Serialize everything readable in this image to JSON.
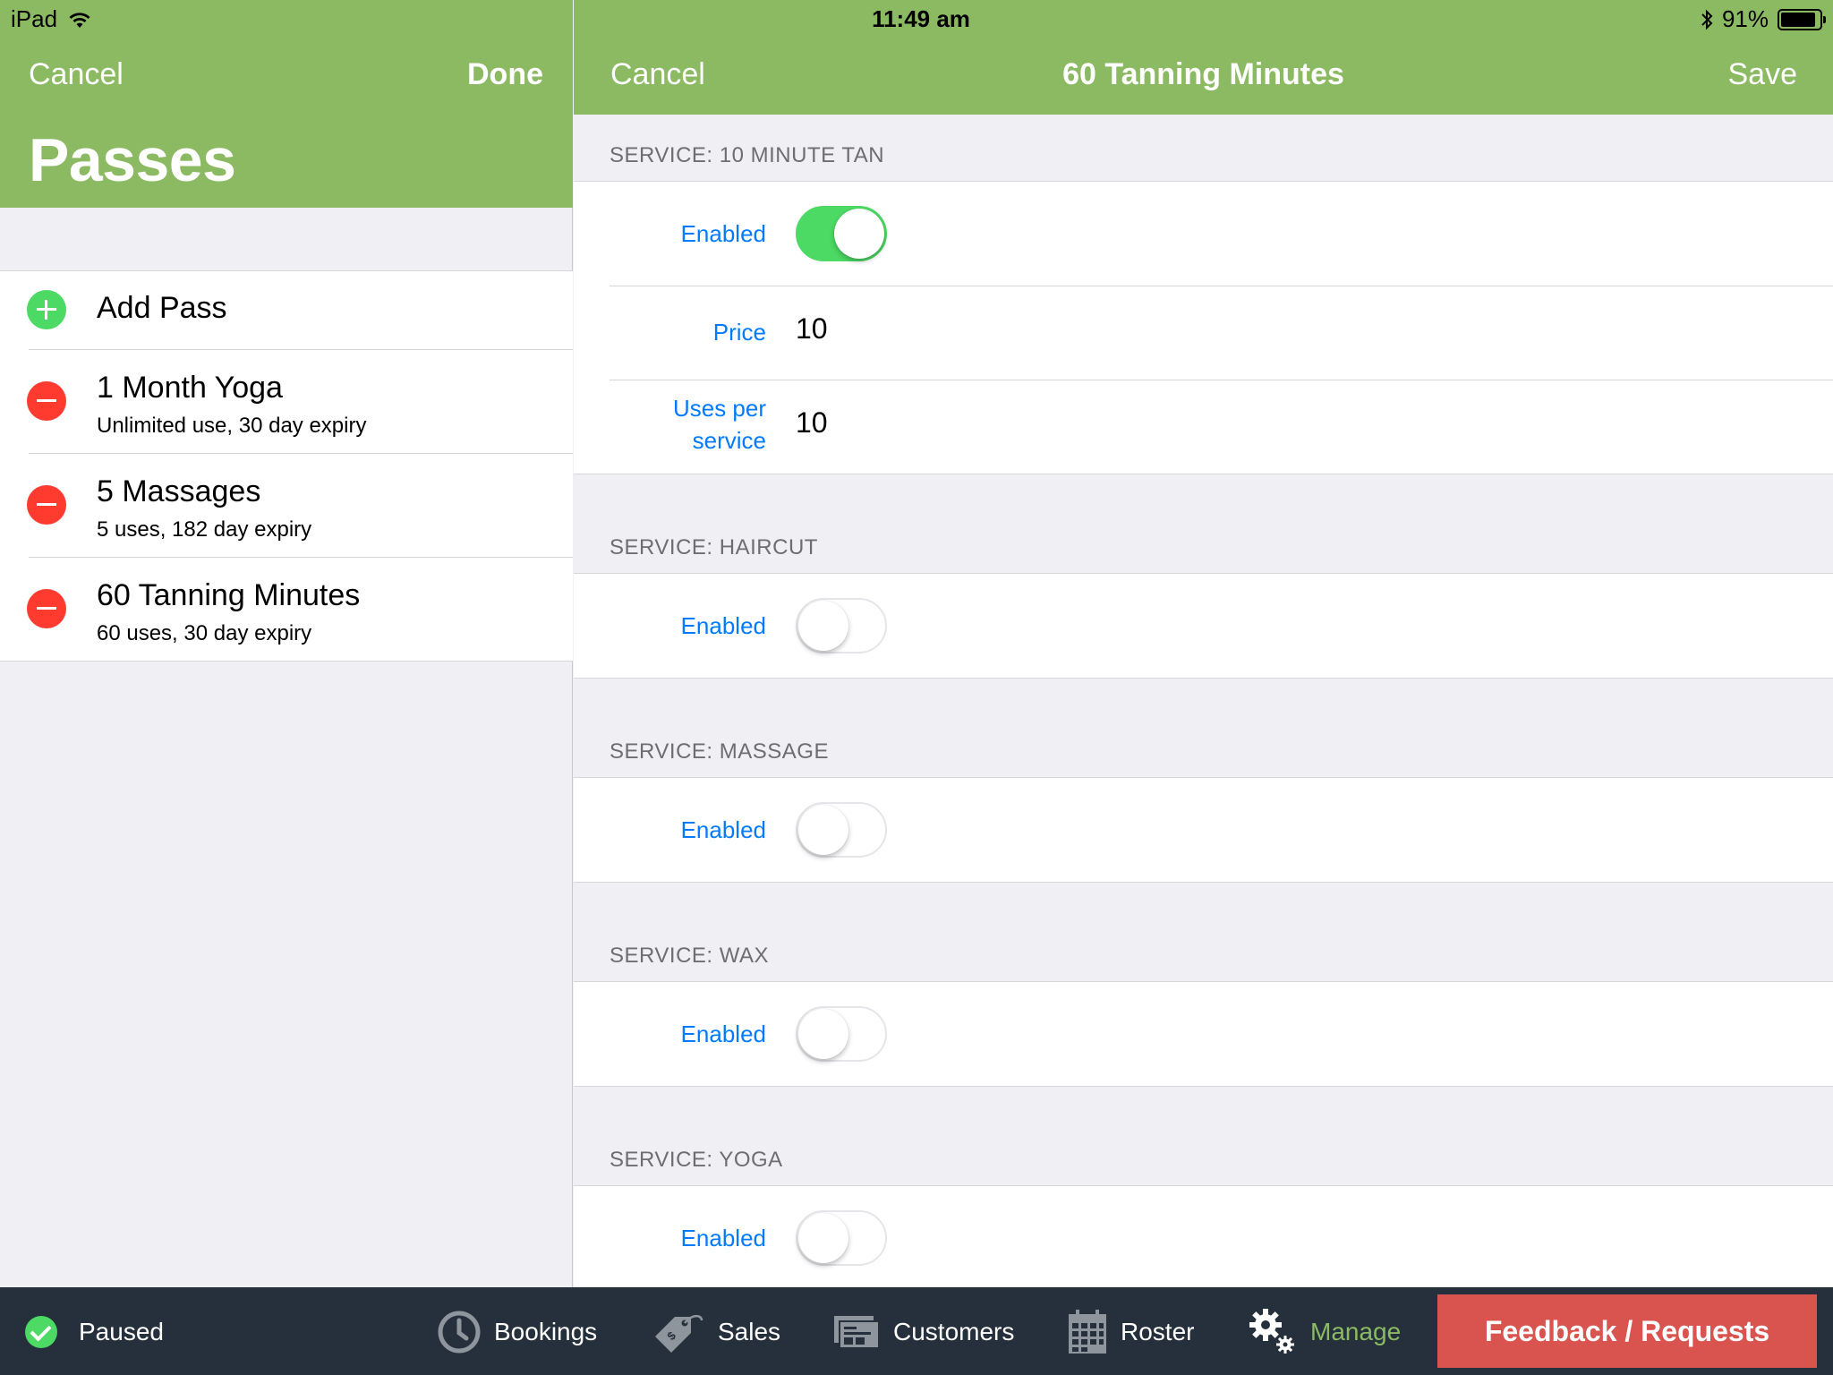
{
  "status_bar": {
    "device": "iPad",
    "time": "11:49 am",
    "battery": "91%",
    "battery_level": 0.91
  },
  "master": {
    "cancel_label": "Cancel",
    "done_label": "Done",
    "title": "Passes",
    "add_label": "Add Pass",
    "passes": [
      {
        "name": "1 Month Yoga",
        "detail": "Unlimited use, 30 day expiry"
      },
      {
        "name": "5 Massages",
        "detail": "5 uses, 182 day expiry"
      },
      {
        "name": "60 Tanning Minutes",
        "detail": "60 uses, 30 day expiry"
      }
    ]
  },
  "detail": {
    "cancel_label": "Cancel",
    "title": "60 Tanning Minutes",
    "save_label": "Save",
    "services": [
      {
        "header": "SERVICE: 10 MINUTE TAN",
        "enabled_label": "Enabled",
        "enabled": true,
        "price_label": "Price",
        "price": "10",
        "uses_label_line1": "Uses per",
        "uses_label_line2": "service",
        "uses": "10"
      },
      {
        "header": "SERVICE: HAIRCUT",
        "enabled_label": "Enabled",
        "enabled": false
      },
      {
        "header": "SERVICE: MASSAGE",
        "enabled_label": "Enabled",
        "enabled": false
      },
      {
        "header": "SERVICE: WAX",
        "enabled_label": "Enabled",
        "enabled": false
      },
      {
        "header": "SERVICE: YOGA",
        "enabled_label": "Enabled",
        "enabled": false
      }
    ]
  },
  "tabbar": {
    "status": "Paused",
    "tabs": [
      {
        "label": "Bookings",
        "icon": "clock-icon",
        "active": false
      },
      {
        "label": "Sales",
        "icon": "price-tag-icon",
        "active": false
      },
      {
        "label": "Customers",
        "icon": "cards-icon",
        "active": false
      },
      {
        "label": "Roster",
        "icon": "calendar-icon",
        "active": false
      },
      {
        "label": "Manage",
        "icon": "gears-icon",
        "active": true
      }
    ],
    "feedback_label": "Feedback / Requests"
  },
  "colors": {
    "nav_green": "#8cba62",
    "ios_blue": "#007aff",
    "toggle_green": "#4cd964",
    "delete_red": "#ff3b30",
    "tabbar_bg": "#25303c",
    "feedback_red": "#d9534f"
  }
}
